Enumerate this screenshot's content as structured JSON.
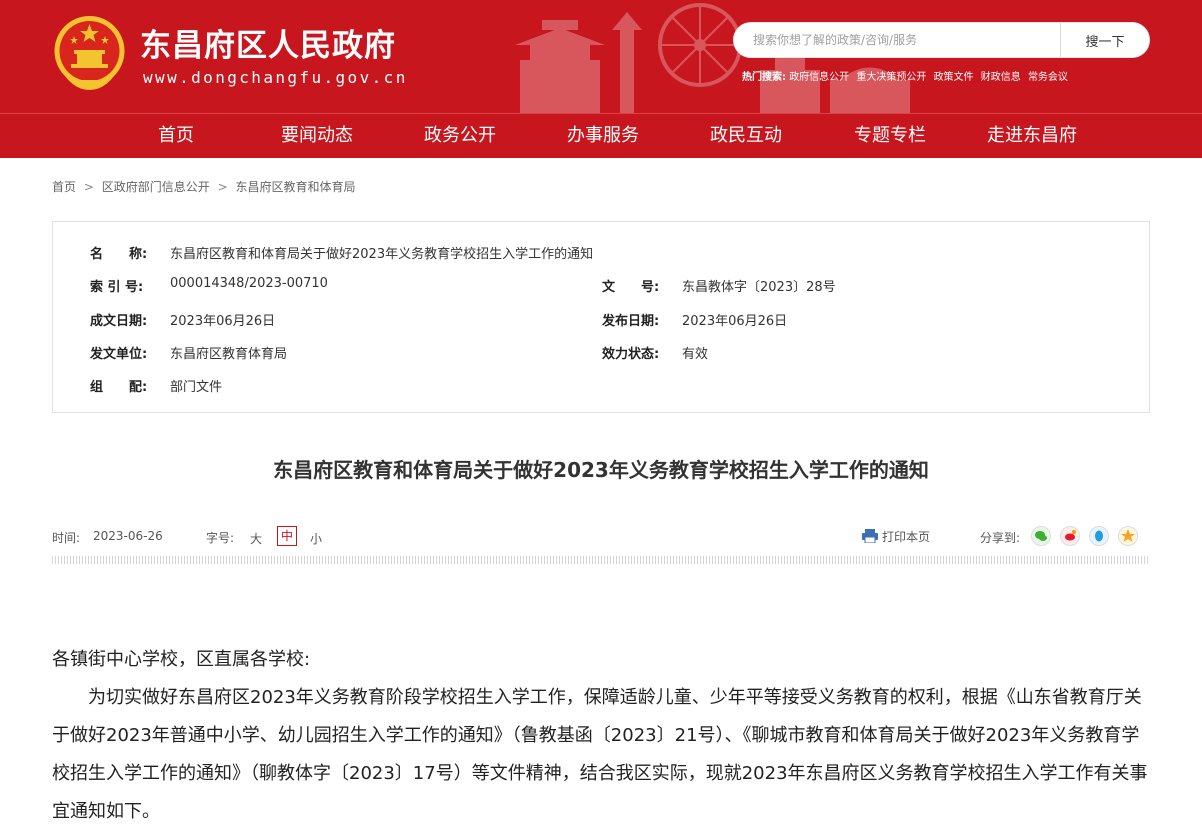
{
  "site": {
    "title": "东昌府区人民政府",
    "domain": "www.dongchangfu.gov.cn"
  },
  "search": {
    "placeholder": "搜索你想了解的政策/咨询/服务",
    "button_label": "搜一下",
    "hot_label": "热门搜索:",
    "hot_items": [
      "政府信息公开",
      "重大决策预公开",
      "政策文件",
      "财政信息",
      "常务会议"
    ]
  },
  "nav": {
    "items": [
      "首页",
      "要闻动态",
      "政务公开",
      "办事服务",
      "政民互动",
      "专题专栏",
      "走进东昌府"
    ]
  },
  "breadcrumb": {
    "items": [
      "首页",
      "区政府部门信息公开",
      "东昌府区教育和体育局"
    ],
    "separator": ">"
  },
  "info": {
    "name_label": "名　　称:",
    "name_value": "东昌府区教育和体育局关于做好2023年义务教育学校招生入学工作的通知",
    "index_label": "索 引 号:",
    "index_value": "000014348/2023-00710",
    "doc_no_label": "文　　号:",
    "doc_no_value": "东昌教体字〔2023〕28号",
    "written_label": "成文日期:",
    "written_value": "2023年06月26日",
    "published_label": "发布日期:",
    "published_value": "2023年06月26日",
    "issuer_label": "发文单位:",
    "issuer_value": "东昌府区教育体育局",
    "status_label": "效力状态:",
    "status_value": "有效",
    "category_label": "组　　配:",
    "category_value": "部门文件"
  },
  "article": {
    "title": "东昌府区教育和体育局关于做好2023年义务教育学校招生入学工作的通知",
    "time_label": "时间:",
    "time_value": "2023-06-26",
    "font_size_label": "字号:",
    "size_large": "大",
    "size_medium": "中",
    "size_small": "小",
    "print_label": "打印本页",
    "share_label": "分享到:",
    "share_icons": [
      "wechat-icon",
      "weibo-icon",
      "qq-icon",
      "qzone-icon"
    ],
    "salutation": "各镇街中心学校，区直属各学校:",
    "paragraph1": "为切实做好东昌府区2023年义务教育阶段学校招生入学工作，保障适龄儿童、少年平等接受义务教育的权利，根据《山东省教育厅关于做好2023年普通中小学、幼儿园招生入学工作的通知》（鲁教基函〔2023〕21号）、《聊城市教育和体育局关于做好2023年义务教育学校招生入学工作的通知》（聊教体字〔2023〕17号）等文件精神，结合我区实际，现就2023年东昌府区义务教育学校招生入学工作有关事宜通知如下。"
  },
  "colors": {
    "brand_red": "#c8161e",
    "text_dark": "#222222"
  }
}
